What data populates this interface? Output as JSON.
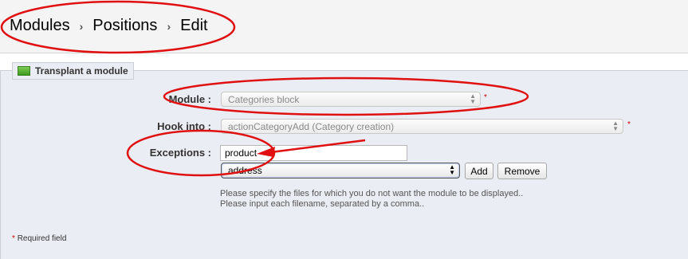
{
  "breadcrumb": {
    "items": [
      "Modules",
      "Positions",
      "Edit"
    ],
    "separator": "›"
  },
  "panel": {
    "title": "Transplant a module",
    "icon": "module-icon"
  },
  "form": {
    "module": {
      "label": "Module :",
      "value": "Categories block"
    },
    "hook": {
      "label": "Hook into :",
      "value": "actionCategoryAdd (Category creation)"
    },
    "exceptions": {
      "label": "Exceptions :",
      "input_value": "product",
      "select_value": "address",
      "add_label": "Add",
      "remove_label": "Remove"
    },
    "help_lines": [
      "Please specify the files for which you do not want the module to be displayed..",
      "Please input each filename, separated by a comma.."
    ],
    "required_marker": "*",
    "required_note": "Required field"
  },
  "colors": {
    "annotation": "#e01010",
    "panel_bg": "#ebedf4",
    "required": "#cc0000"
  }
}
